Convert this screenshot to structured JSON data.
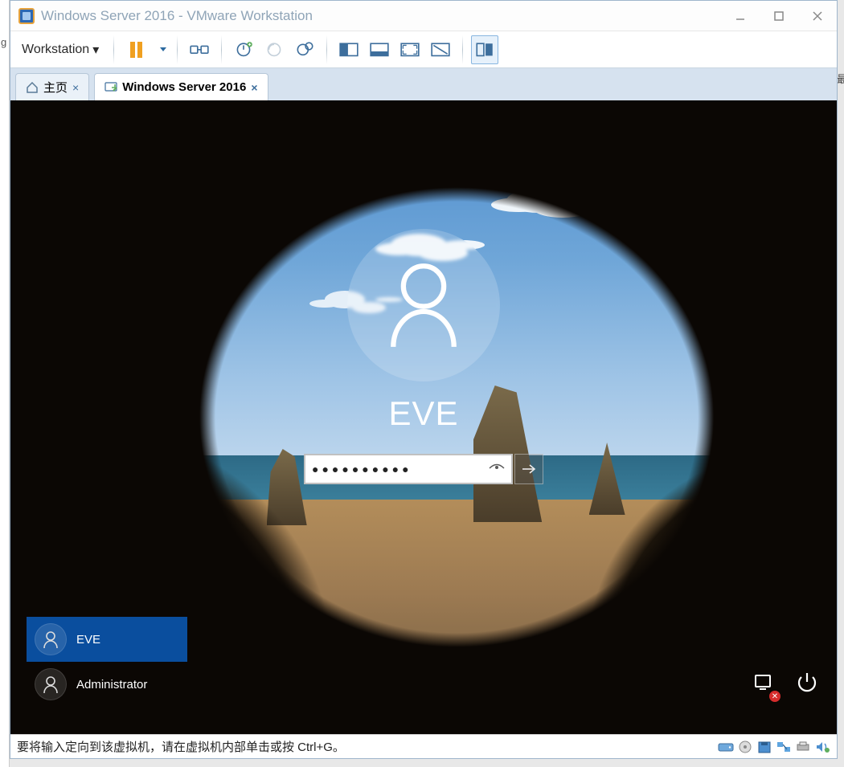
{
  "window": {
    "title": "Windows Server 2016 - VMware Workstation"
  },
  "toolbar": {
    "workstation_menu": "Workstation",
    "icons": {
      "pause": "pause-icon",
      "dropdown": "dropdown-icon",
      "usb": "usb-icon",
      "snapshot": "snapshot-icon",
      "revert": "revert-icon",
      "manage": "manage-snapshots-icon",
      "fit_guest": "fit-guest-icon",
      "fit_window": "fit-window-icon",
      "fullscreen": "fullscreen-icon",
      "unity": "unity-icon",
      "library": "library-icon"
    }
  },
  "tabs": [
    {
      "label": "主页",
      "active": false,
      "icon": "home-icon"
    },
    {
      "label": "Windows Server 2016",
      "active": true,
      "icon": "vm-icon"
    }
  ],
  "login": {
    "username": "EVE",
    "password_masked": "●●●●●●●●●●",
    "users": [
      {
        "name": "EVE",
        "selected": true
      },
      {
        "name": "Administrator",
        "selected": false
      }
    ],
    "accessibility_icon": "ease-of-access-icon",
    "network_icon": "network-disconnected-icon",
    "power_icon": "power-icon"
  },
  "statusbar": {
    "message": "要将输入定向到该虚拟机，请在虚拟机内部单击或按 Ctrl+G。",
    "icons": [
      "disk-icon",
      "cdrom-icon",
      "floppy-icon",
      "network-adapter-icon",
      "printer-icon",
      "sound-icon"
    ]
  }
}
